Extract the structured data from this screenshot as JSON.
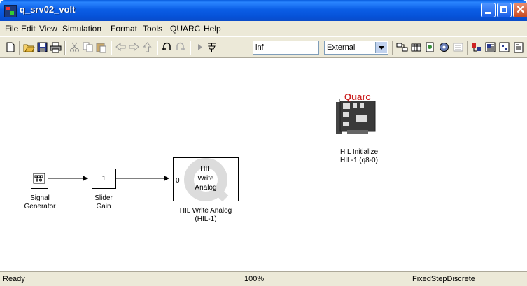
{
  "window": {
    "title": "q_srv02_volt"
  },
  "menu": [
    {
      "label": "File"
    },
    {
      "label": "Edit"
    },
    {
      "label": "View"
    },
    {
      "label": "Simulation"
    },
    {
      "label": "Format"
    },
    {
      "label": "Tools"
    },
    {
      "label": "QUARC"
    },
    {
      "label": "Help"
    }
  ],
  "toolbar": {
    "stop_time": "inf",
    "simulation_mode": "External",
    "icons": [
      "new-model-icon",
      "open-icon",
      "save-icon",
      "print-icon",
      "cut-icon",
      "copy-icon",
      "paste-icon",
      "back-icon",
      "forward-icon",
      "up-icon",
      "undo-icon",
      "redo-icon",
      "start-icon",
      "stop-icon",
      "build-icon",
      "library-icon",
      "model-explorer-icon",
      "debug-icon",
      "connect-icon",
      "external-mode-icon",
      "library-browser-icon"
    ]
  },
  "blocks": {
    "signal_generator": {
      "label_line1": "Signal",
      "label_line2": "Generator"
    },
    "slider_gain": {
      "value": "1",
      "label_line1": "Slider",
      "label_line2": "Gain"
    },
    "hil_write_analog": {
      "inner_line1": "HIL",
      "inner_line2": "Write",
      "inner_line3": "Analog",
      "port": "0",
      "label_line1": "HIL Write Analog",
      "label_line2": "(HIL-1)"
    },
    "hil_initialize": {
      "brand": "Quarc",
      "label_line1": "HIL Initialize",
      "label_line2": "HIL-1 (q8-0)"
    }
  },
  "status": {
    "state": "Ready",
    "zoom": "100%",
    "solver": "FixedStepDiscrete"
  },
  "colors": {
    "title_bar": "#0a5fe0",
    "chrome": "#ece9d8",
    "quarc_red": "#cc2222"
  }
}
